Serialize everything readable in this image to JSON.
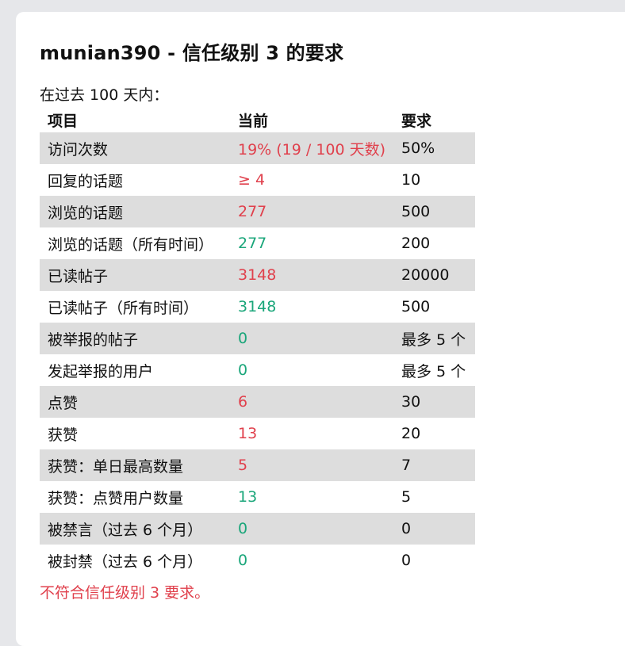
{
  "title": "munian390 - 信任级别 3 的要求",
  "subtitle": "在过去 100 天内：",
  "columns": [
    "项目",
    "当前",
    "要求"
  ],
  "rows": [
    {
      "item": "访问次数",
      "current": "19% (19 / 100 天数)",
      "required": "50%",
      "status": "bad"
    },
    {
      "item": "回复的话题",
      "current": "≥ 4",
      "required": "10",
      "status": "bad"
    },
    {
      "item": "浏览的话题",
      "current": "277",
      "required": "500",
      "status": "bad"
    },
    {
      "item": "浏览的话题（所有时间）",
      "current": "277",
      "required": "200",
      "status": "good"
    },
    {
      "item": "已读帖子",
      "current": "3148",
      "required": "20000",
      "status": "bad"
    },
    {
      "item": "已读帖子（所有时间）",
      "current": "3148",
      "required": "500",
      "status": "good"
    },
    {
      "item": "被举报的帖子",
      "current": "0",
      "required": "最多 5 个",
      "status": "good"
    },
    {
      "item": "发起举报的用户",
      "current": "0",
      "required": "最多 5 个",
      "status": "good"
    },
    {
      "item": "点赞",
      "current": "6",
      "required": "30",
      "status": "bad"
    },
    {
      "item": "获赞",
      "current": "13",
      "required": "20",
      "status": "bad"
    },
    {
      "item": "获赞：单日最高数量",
      "current": "5",
      "required": "7",
      "status": "bad"
    },
    {
      "item": "获赞：点赞用户数量",
      "current": "13",
      "required": "5",
      "status": "good"
    },
    {
      "item": "被禁言（过去 6 个月）",
      "current": "0",
      "required": "0",
      "status": "good"
    },
    {
      "item": "被封禁（过去 6 个月）",
      "current": "0",
      "required": "0",
      "status": "good"
    }
  ],
  "verdict": "不符合信任级别 3 要求。",
  "colors": {
    "bad": "#e0404c",
    "good": "#1aa67a",
    "stripe": "#dddddd",
    "background": "#e6e7ea",
    "card": "#ffffff"
  }
}
